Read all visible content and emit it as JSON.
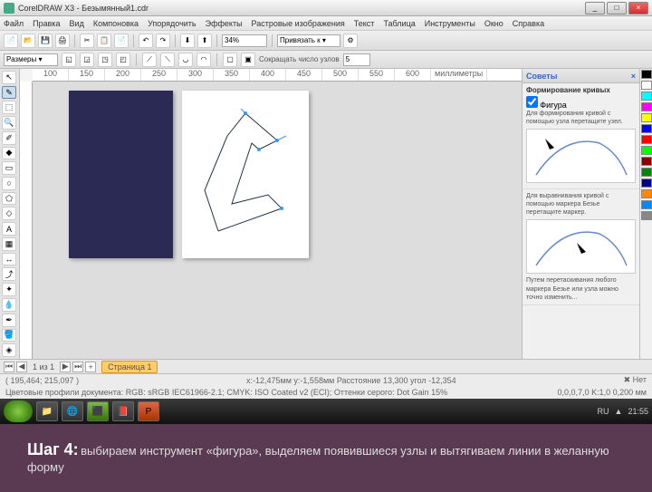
{
  "title": "CorelDRAW X3 - Безымянный1.cdr",
  "winbtns": {
    "min": "_",
    "max": "□",
    "close": "×"
  },
  "menu": [
    "Файл",
    "Правка",
    "Вид",
    "Компоновка",
    "Упорядочить",
    "Эффекты",
    "Растровые изображения",
    "Текст",
    "Таблица",
    "Инструменты",
    "Окно",
    "Справка"
  ],
  "toolbar": {
    "zoom": "34%",
    "align": "Привязать к ▾"
  },
  "propbar": {
    "preset": "Размеры ▾",
    "reduce": "Сокращать число узлов"
  },
  "ruler": [
    "100",
    "150",
    "200",
    "250",
    "300",
    "350",
    "400",
    "450",
    "500",
    "550",
    "600"
  ],
  "ruler_unit": "миллиметры",
  "docker": {
    "title": "Советы",
    "section1_title": "Формирование кривых",
    "section1_check": "Фигура",
    "section1_text": "Для формирования кривой с помощью узла перетащите узел.",
    "section2_text": "Для выравнивания кривой с помощью маркера Безье перетащите маркер.",
    "section3_text": "Путем перетаскивания любого маркера Безье или узла можно точно изменить..."
  },
  "colors": [
    "#000",
    "#fff",
    "#f00",
    "#0f0",
    "#00f",
    "#ff0",
    "#f0f",
    "#0ff",
    "#800",
    "#080",
    "#008",
    "#880",
    "#f80",
    "#08f",
    "#888",
    "#ccc"
  ],
  "tabs": {
    "count": "1 из 1",
    "page": "Страница 1"
  },
  "status": {
    "coords": "( 195,464; 215,097 )",
    "center": "x:-12,475мм y:-1,558мм Расстояние 13,300 угол -12,354",
    "profile": "Цветовые профили документа: RGB: sRGB IEC61966-2.1; CMYK: ISO Coated v2 (ECI); Оттенки серого: Dot Gain 15%",
    "fill": "Нет",
    "outline": "0,0,0,7,0 K:1,0 0,200 мм"
  },
  "taskbar": {
    "lang": "RU",
    "time": "21:55"
  },
  "caption": {
    "step": "Шаг 4:",
    "desc": "выбираем инструмент «фигура», выделяем появившиеся узлы и вытягиваем линии в желанную форму"
  }
}
